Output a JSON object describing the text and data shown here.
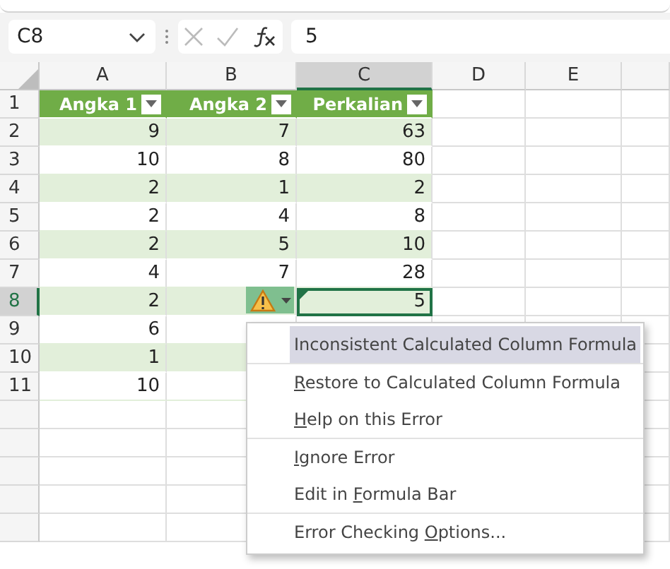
{
  "name_box": {
    "value": "C8"
  },
  "formula_bar": {
    "value": "5"
  },
  "columns": [
    {
      "label": "A",
      "selected": false
    },
    {
      "label": "B",
      "selected": false
    },
    {
      "label": "C",
      "selected": true
    },
    {
      "label": "D",
      "selected": false
    },
    {
      "label": "E",
      "selected": false
    }
  ],
  "table": {
    "header_row_number": "1",
    "headers": [
      "Angka 1",
      "Angka 2",
      "Perkalian"
    ],
    "rows": [
      {
        "number": "2",
        "selected": false,
        "cells": [
          "9",
          "7",
          "63"
        ]
      },
      {
        "number": "3",
        "selected": false,
        "cells": [
          "10",
          "8",
          "80"
        ]
      },
      {
        "number": "4",
        "selected": false,
        "cells": [
          "2",
          "1",
          "2"
        ]
      },
      {
        "number": "5",
        "selected": false,
        "cells": [
          "2",
          "4",
          "8"
        ]
      },
      {
        "number": "6",
        "selected": false,
        "cells": [
          "2",
          "5",
          "10"
        ]
      },
      {
        "number": "7",
        "selected": false,
        "cells": [
          "4",
          "7",
          "28"
        ]
      },
      {
        "number": "8",
        "selected": true,
        "cells": [
          "2",
          null,
          "5"
        ],
        "error_flag": true
      },
      {
        "number": "9",
        "selected": false,
        "cells": [
          "6",
          null,
          null
        ]
      },
      {
        "number": "10",
        "selected": false,
        "cells": [
          "1",
          null,
          null
        ]
      },
      {
        "number": "11",
        "selected": false,
        "cells": [
          "10",
          null,
          null
        ]
      }
    ]
  },
  "context_menu": {
    "groups": [
      [
        {
          "pre": "Inconsistent Calculated Column Formula",
          "selected": true
        }
      ],
      [
        {
          "key": "R",
          "post": "estore to Calculated Column Formula",
          "selected": false
        },
        {
          "key": "H",
          "post": "elp on this Error",
          "selected": false
        }
      ],
      [
        {
          "key": "I",
          "post": "gnore Error",
          "selected": false
        },
        {
          "pre": "Edit in ",
          "key": "F",
          "post": "ormula Bar",
          "selected": false
        }
      ],
      [
        {
          "pre": "Error Checking ",
          "key": "O",
          "post": "ptions...",
          "selected": false
        }
      ]
    ]
  }
}
